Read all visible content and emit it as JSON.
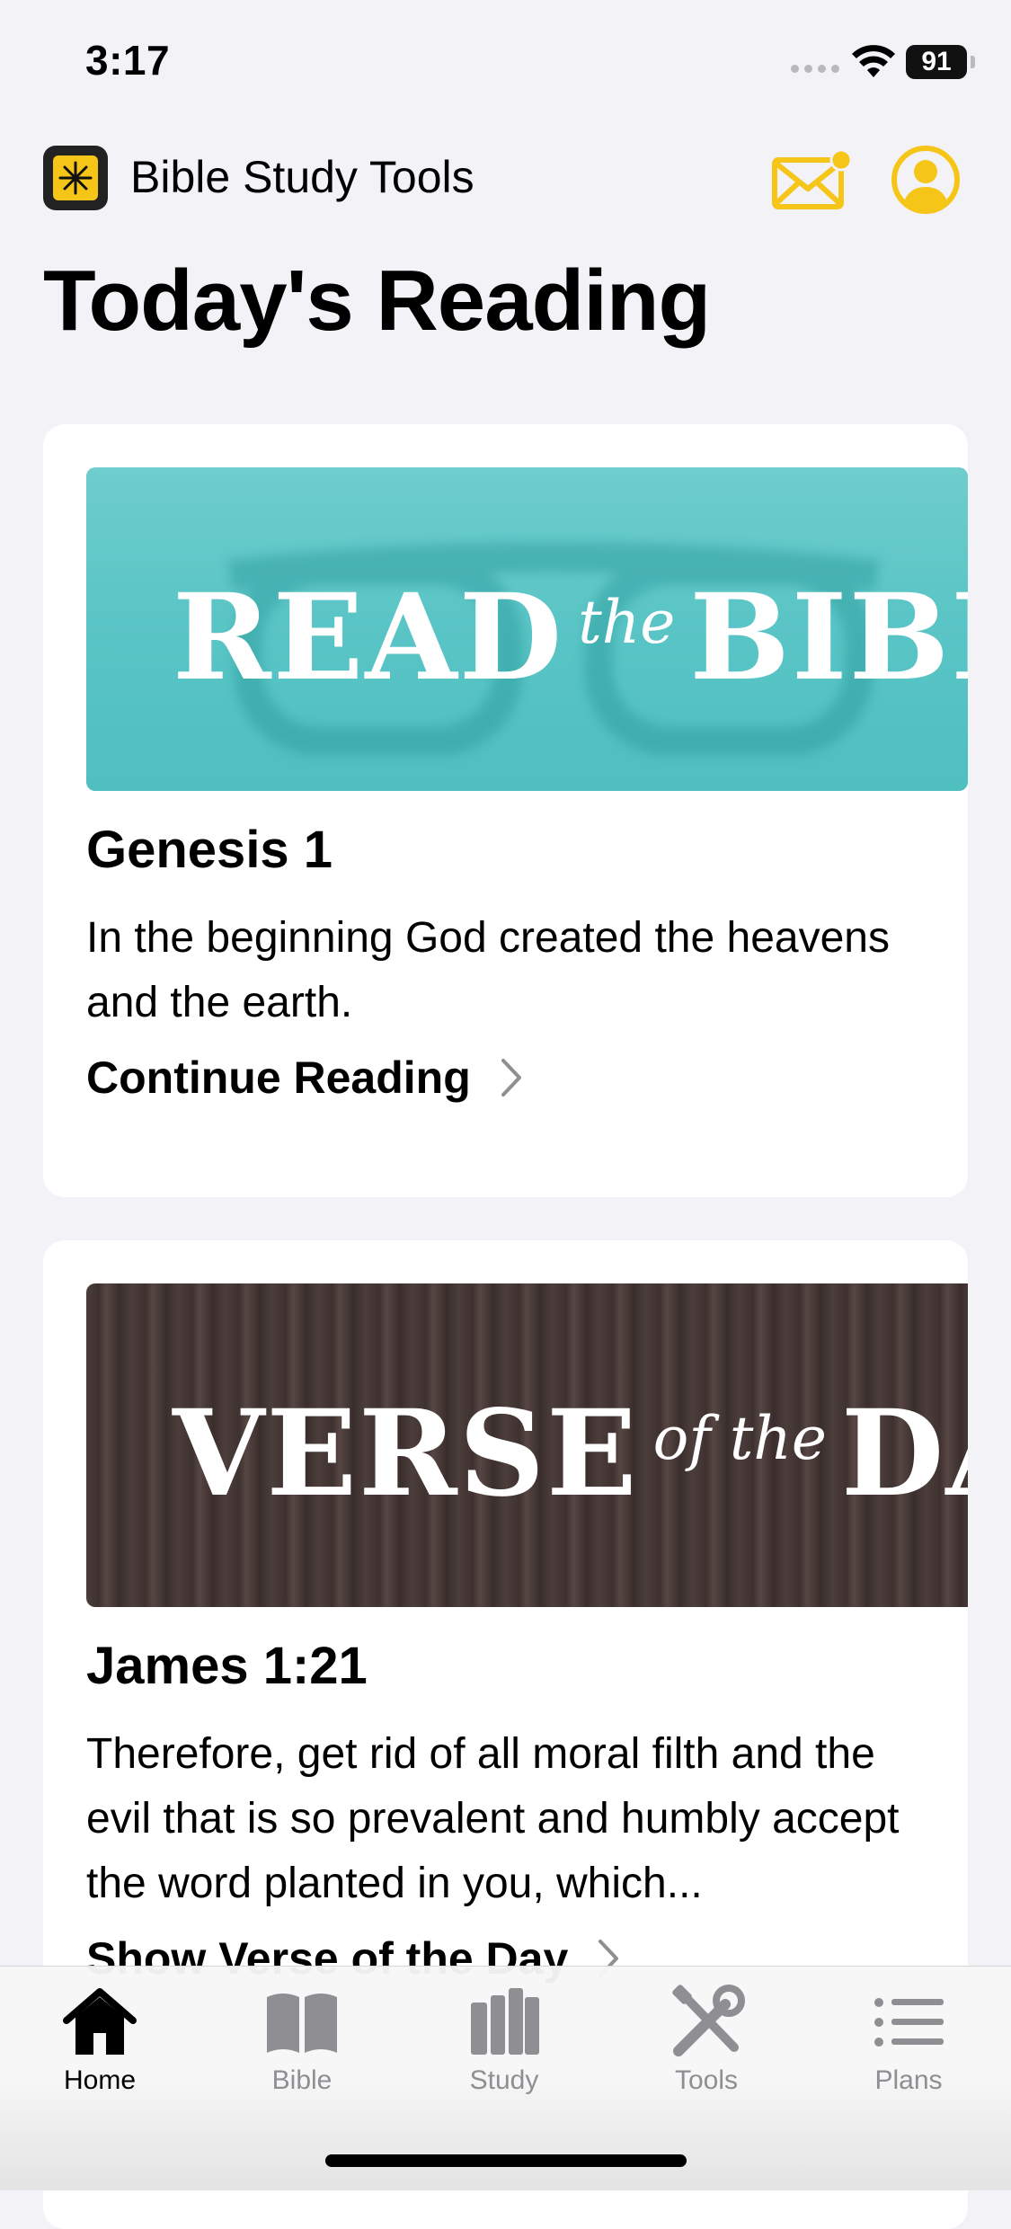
{
  "status_bar": {
    "time": "3:17",
    "battery": "91"
  },
  "header": {
    "app_title": "Bible Study Tools",
    "page_title": "Today's Reading"
  },
  "colors": {
    "accent": "#f5c518",
    "background": "#f2f2f7",
    "reading_banner": "#5bc5c6"
  },
  "cards": [
    {
      "banner": {
        "big1": "READ",
        "small": "the",
        "big2": "BIBLE"
      },
      "reference": "Genesis 1",
      "body": "In the beginning God created the heavens and the earth.",
      "link": "Continue Reading"
    },
    {
      "banner": {
        "big1": "VERSE",
        "small": "of the",
        "big2": "DAY"
      },
      "reference": "James 1:21",
      "body": "Therefore, get rid of all moral filth and the evil that is so prevalent and humbly accept the word planted in you, which...",
      "link": "Show Verse of the Day"
    }
  ],
  "tabs": [
    {
      "label": "Home",
      "icon": "home-icon",
      "active": true
    },
    {
      "label": "Bible",
      "icon": "bible-icon",
      "active": false
    },
    {
      "label": "Study",
      "icon": "study-icon",
      "active": false
    },
    {
      "label": "Tools",
      "icon": "tools-icon",
      "active": false
    },
    {
      "label": "Plans",
      "icon": "plans-icon",
      "active": false
    }
  ]
}
